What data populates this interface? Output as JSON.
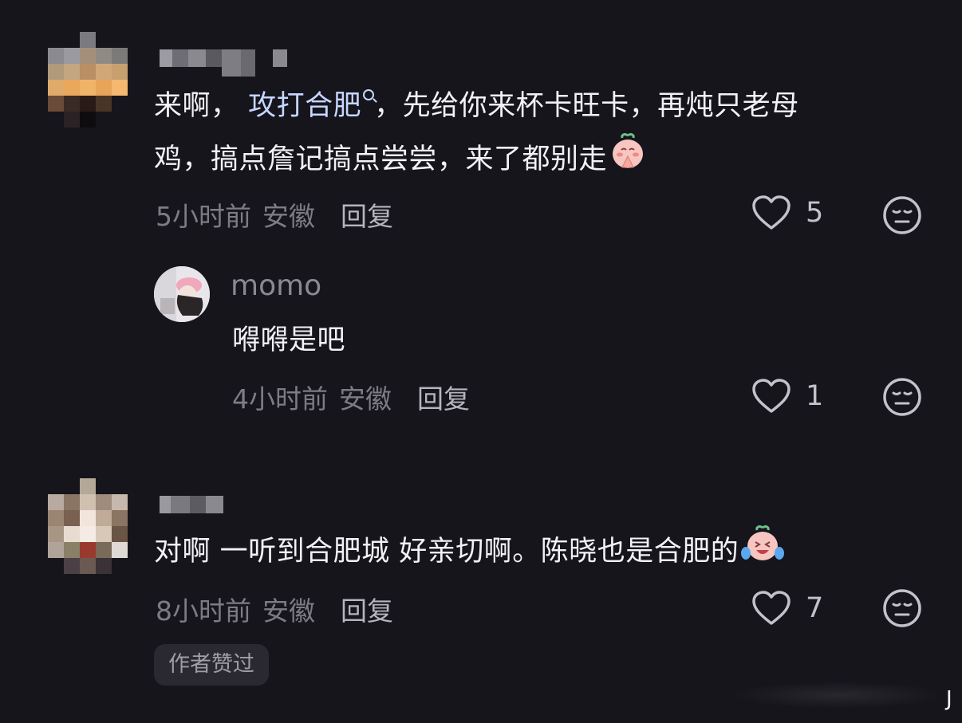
{
  "colors": {
    "background": "#16151c",
    "text": "#f2f2f5",
    "muted": "#7d7b85",
    "reply": "#b6b4bd",
    "link": "#c6d6ff",
    "badge_bg": "#2a2931"
  },
  "comments": [
    {
      "text_before": "来啊，",
      "topic": "攻打合肥",
      "line1_rest": "，先给你来杯卡旺卡，再炖只老母",
      "line2": "鸡，搞点詹记搞点尝尝，来了都别走",
      "emoji": "praying-peach-emoji",
      "time": "5小时前",
      "location": "安徽",
      "reply_label": "回复",
      "likes": "5",
      "reply": {
        "username": "momo",
        "text": "嘚嘚是吧",
        "time": "4小时前",
        "location": "安徽",
        "reply_label": "回复",
        "likes": "1"
      }
    },
    {
      "text": "对啊 一听到合肥城 好亲切啊。陈晓也是合肥的",
      "emoji": "crying-laughing-peach-emoji",
      "time": "8小时前",
      "location": "安徽",
      "reply_label": "回复",
      "likes": "7",
      "badge": "作者赞过"
    }
  ],
  "corner_glyph": "J"
}
